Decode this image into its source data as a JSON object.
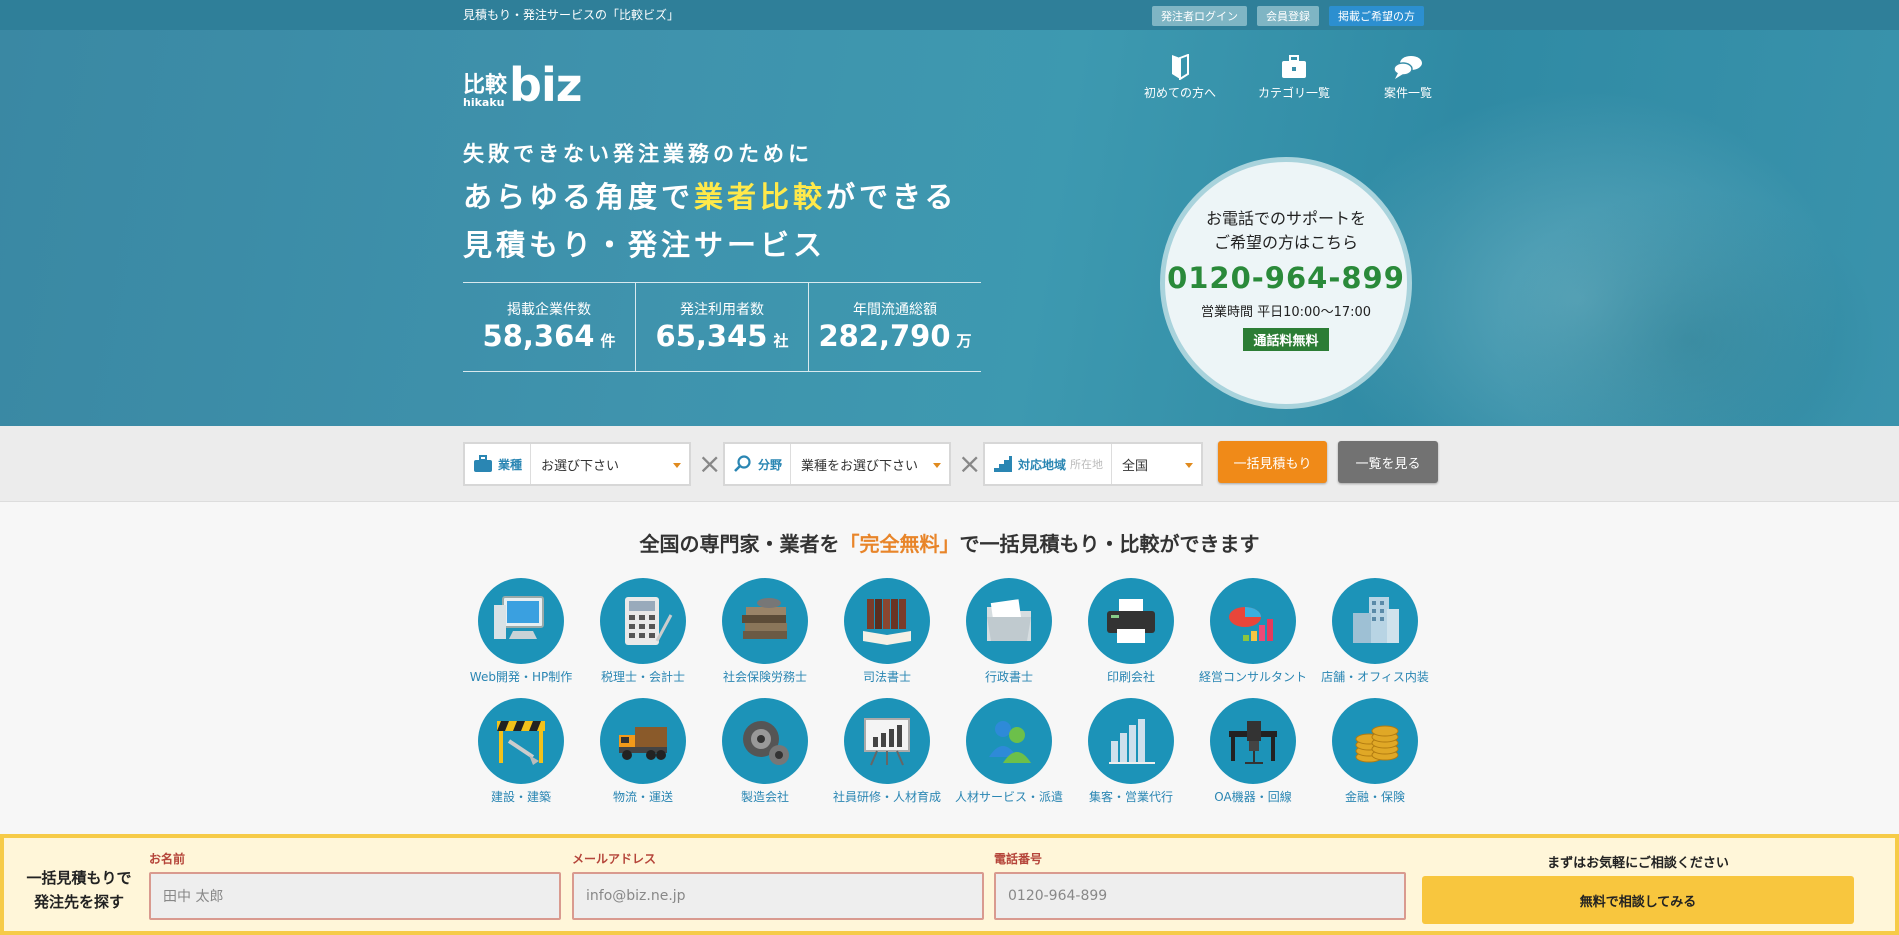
{
  "topbar": {
    "tagline": "見積もり・発注サービスの「比較ビズ」",
    "links": [
      {
        "label": "発注者ログイン",
        "bg": "#7fb5c4"
      },
      {
        "label": "会員登録",
        "bg": "#7fb5c4"
      },
      {
        "label": "掲載ご希望の方",
        "bg": "#2c8fd0"
      }
    ]
  },
  "logo": {
    "jp": "比較",
    "romaji": "hikaku",
    "biz": "biz"
  },
  "nav": [
    {
      "label": "初めての方へ",
      "icon": "beginner-icon"
    },
    {
      "label": "カテゴリ一覧",
      "icon": "briefcase-icon"
    },
    {
      "label": "案件一覧",
      "icon": "speech-bubble-icon"
    }
  ],
  "headline": {
    "line1": "失敗できない発注業務のために",
    "line2_pre": "あらゆる角度で",
    "line2_highlight": "業者比較",
    "line2_post": "ができる",
    "line3": "見積もり・発注サービス"
  },
  "stats": [
    {
      "label": "掲載企業件数",
      "value": "58,364",
      "unit": "件"
    },
    {
      "label": "発注利用者数",
      "value": "65,345",
      "unit": "社"
    },
    {
      "label": "年間流通総額",
      "value": "282,790",
      "unit": "万"
    }
  ],
  "support": {
    "line1": "お電話でのサポートを",
    "line2": "ご希望の方はこちら",
    "phone": "0120-964-899",
    "hours": "営業時間 平日10:00〜17:00",
    "free": "通話料無料"
  },
  "search": {
    "industry": {
      "caption": "業種",
      "value": "お選び下さい"
    },
    "field": {
      "caption": "分野",
      "value": "業種をお選び下さい"
    },
    "region": {
      "caption": "対応地域",
      "sub": "所在地",
      "value": "全国"
    },
    "times": "×",
    "bulk_button": "一括見積もり",
    "list_button": "一覧を見る"
  },
  "categories_title": {
    "pre": "全国の専門家・業者を",
    "em": "「完全無料」",
    "post": "で一括見積もり・比較ができます"
  },
  "categories": [
    {
      "label": "Web開発・HP制作",
      "icon": "computer-icon"
    },
    {
      "label": "税理士・会計士",
      "icon": "calculator-icon"
    },
    {
      "label": "社会保険労務士",
      "icon": "books-icon"
    },
    {
      "label": "司法書士",
      "icon": "law-books-icon"
    },
    {
      "label": "行政書士",
      "icon": "folder-icon"
    },
    {
      "label": "印刷会社",
      "icon": "printer-icon"
    },
    {
      "label": "経営コンサルタント",
      "icon": "pie-chart-icon"
    },
    {
      "label": "店舗・オフィス内装",
      "icon": "building-icon"
    },
    {
      "label": "建設・建築",
      "icon": "construction-icon"
    },
    {
      "label": "物流・運送",
      "icon": "truck-icon"
    },
    {
      "label": "製造会社",
      "icon": "gear-icon"
    },
    {
      "label": "社員研修・人材育成",
      "icon": "presentation-board-icon"
    },
    {
      "label": "人材サービス・派遣",
      "icon": "people-icon"
    },
    {
      "label": "集客・営業代行",
      "icon": "bar-chart-icon"
    },
    {
      "label": "OA機器・回線",
      "icon": "office-desk-icon"
    },
    {
      "label": "金融・保険",
      "icon": "coins-icon"
    }
  ],
  "bottom": {
    "lead1": "一括見積もりで",
    "lead2": "発注先を探す",
    "name_label": "お名前",
    "name_placeholder": "田中 太郎",
    "email_label": "メールアドレス",
    "email_placeholder": "info@biz.ne.jp",
    "phone_label": "電話番号",
    "phone_placeholder": "0120-964-899",
    "cta_lead": "まずはお気軽にご相談ください",
    "cta": "無料で相談してみる"
  }
}
